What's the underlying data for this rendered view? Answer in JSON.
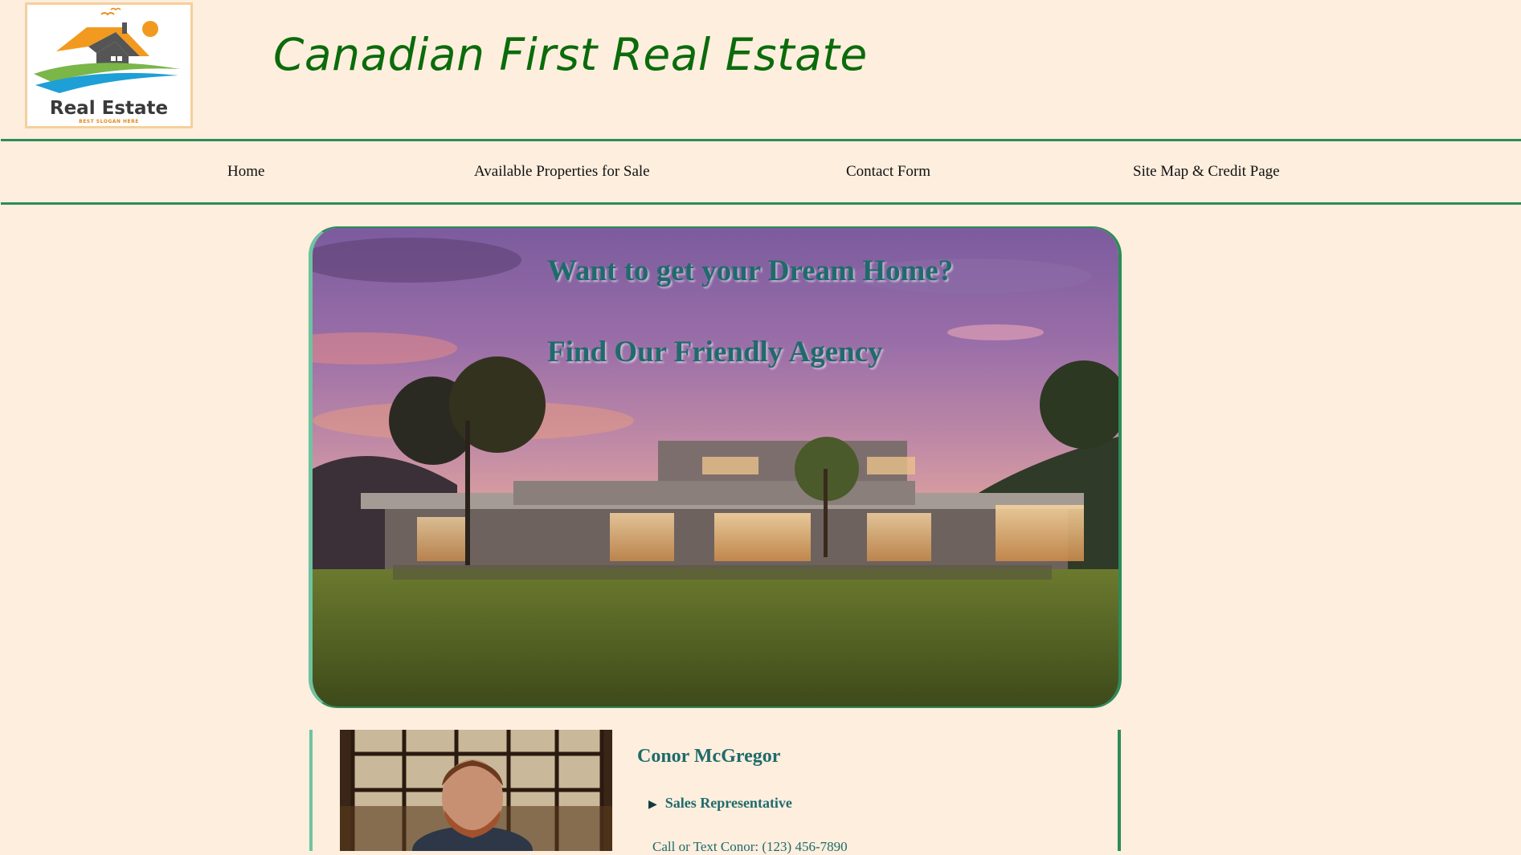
{
  "header": {
    "logo": {
      "text": "Real Estate",
      "slogan": "BEST SLOGAN HERE",
      "icon": "house-logo-icon"
    },
    "site_title": "Canadian First Real Estate"
  },
  "nav": {
    "items": [
      {
        "label": "Home"
      },
      {
        "label": "Available Properties for Sale"
      },
      {
        "label": "Contact Form"
      },
      {
        "label": "Site Map & Credit Page"
      }
    ]
  },
  "hero": {
    "line1": "Want to get your Dream Home?",
    "line2": "Find Our Friendly Agency"
  },
  "agent": {
    "name": "Conor McGregor",
    "title": "Sales Representative",
    "contact_prefix": "Call or Text Conor:",
    "phone": "(123) 456-7890"
  },
  "colors": {
    "background": "#fdeede",
    "accent_green": "#2e8b57",
    "title_green": "#0b6b0b",
    "teal_text": "#1f6b6b"
  }
}
